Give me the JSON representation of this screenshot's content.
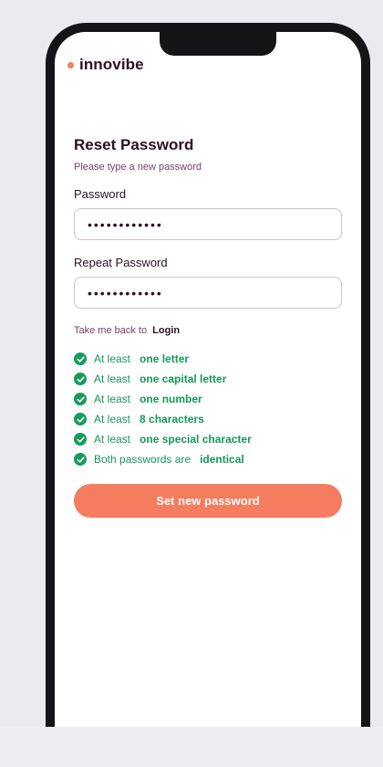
{
  "brand": {
    "name": "innovibe",
    "accent_color": "#f47c5f"
  },
  "form": {
    "title": "Reset Password",
    "subtitle": "Please type a new password",
    "password_label": "Password",
    "password_value": "••••••••••••",
    "repeat_label": "Repeat Password",
    "repeat_value": "••••••••••••",
    "back_prefix": "Take me back to",
    "back_link": "Login",
    "submit_label": "Set new password"
  },
  "requirements": [
    {
      "prefix": "At least",
      "strong": "one letter",
      "met": true
    },
    {
      "prefix": "At least",
      "strong": "one capital letter",
      "met": true
    },
    {
      "prefix": "At least",
      "strong": "one number",
      "met": true
    },
    {
      "prefix": "At least",
      "strong": "8 characters",
      "met": true
    },
    {
      "prefix": "At least",
      "strong": "one special character",
      "met": true
    },
    {
      "prefix": "Both passwords are",
      "strong": "identical",
      "met": true
    }
  ],
  "colors": {
    "success": "#169c5c",
    "text_dark": "#2c0f22",
    "text_muted": "#7a3e66"
  }
}
